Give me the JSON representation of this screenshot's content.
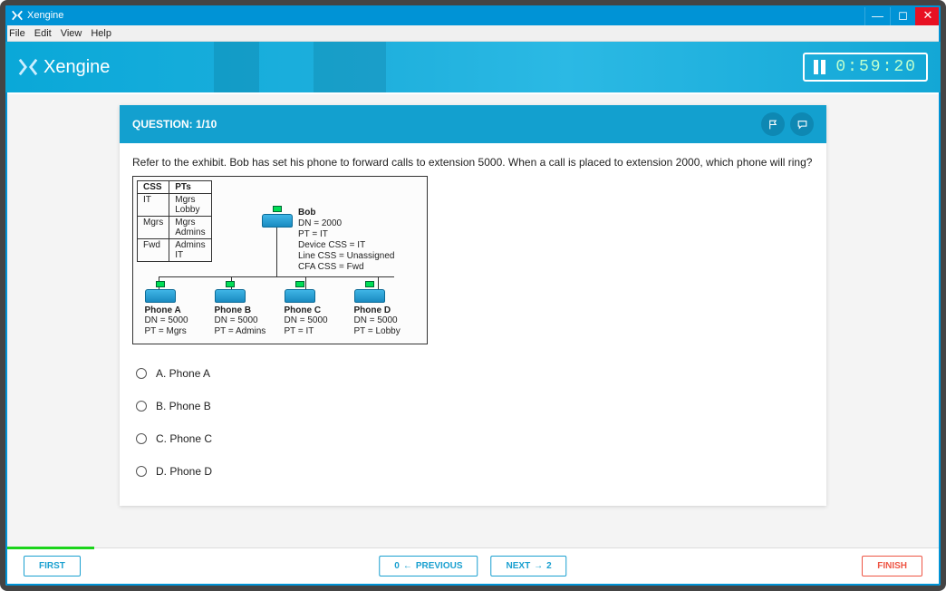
{
  "window": {
    "title": "Xengine"
  },
  "menu": {
    "items": [
      "File",
      "Edit",
      "View",
      "Help"
    ]
  },
  "header": {
    "app_name": "Xengine",
    "timer": "0:59:20"
  },
  "question": {
    "counter_label": "QUESTION: 1/10",
    "prompt": "Refer to the exhibit. Bob has set his phone to forward calls to extension 5000. When a call is placed to extension 2000, which phone will ring?"
  },
  "exhibit": {
    "css_table": {
      "headers": [
        "CSS",
        "PTs"
      ],
      "rows": [
        [
          "IT",
          "Mgrs\nLobby"
        ],
        [
          "Mgrs",
          "Mgrs\nAdmins"
        ],
        [
          "Fwd",
          "Admins\nIT"
        ]
      ]
    },
    "bob": {
      "name": "Bob",
      "lines": [
        "DN = 2000",
        "PT = IT",
        "Device CSS = IT",
        "Line CSS = Unassigned",
        "CFA CSS = Fwd"
      ]
    },
    "phones": [
      {
        "name": "Phone A",
        "dn": "DN = 5000",
        "pt": "PT = Mgrs"
      },
      {
        "name": "Phone B",
        "dn": "DN = 5000",
        "pt": "PT = Admins"
      },
      {
        "name": "Phone C",
        "dn": "DN = 5000",
        "pt": "PT = IT"
      },
      {
        "name": "Phone D",
        "dn": "DN = 5000",
        "pt": "PT = Lobby"
      }
    ]
  },
  "answers": [
    {
      "label": "A. Phone A"
    },
    {
      "label": "B. Phone B"
    },
    {
      "label": "C. Phone C"
    },
    {
      "label": "D. Phone D"
    }
  ],
  "footer": {
    "first": "FIRST",
    "prev_num": "0",
    "prev": "PREVIOUS",
    "next": "NEXT",
    "next_num": "2",
    "finish": "FINISH"
  }
}
